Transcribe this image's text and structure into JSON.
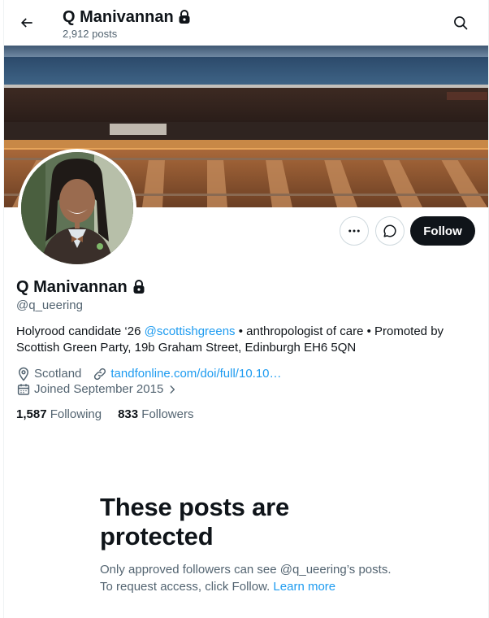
{
  "header": {
    "title": "Q Manivannan",
    "posts_count": "2,912 posts"
  },
  "profile": {
    "name": "Q Manivannan",
    "handle": "@q_ueering",
    "bio_before": "Holyrood candidate ‘26 ",
    "bio_mention": "@scottishgreens",
    "bio_after": " • anthropologist of care • Promoted by Scottish Green Party, 19b Graham Street, Edinburgh EH6 5QN",
    "location": "Scotland",
    "website": "tandfonline.com/doi/full/10.10…",
    "joined": "Joined September 2015",
    "following_count": "1,587",
    "following_label": "Following",
    "followers_count": "833",
    "followers_label": "Followers"
  },
  "actions": {
    "follow_label": "Follow"
  },
  "protected": {
    "title": "These posts are protected",
    "text_before": "Only approved followers can see @q_ueering’s posts. To request access, click Follow. ",
    "learn_more": "Learn more"
  },
  "colors": {
    "accent": "#1d9bf0",
    "text": "#0f1419",
    "secondary": "#536471",
    "follow_bg": "#0f1419"
  },
  "icons": {
    "back": "arrow-left-icon",
    "lock": "lock-icon",
    "search": "search-icon",
    "more": "more-dots-icon",
    "message": "message-icon",
    "location": "location-pin-icon",
    "link": "link-icon",
    "calendar": "calendar-icon",
    "chevron": "chevron-right-icon"
  }
}
